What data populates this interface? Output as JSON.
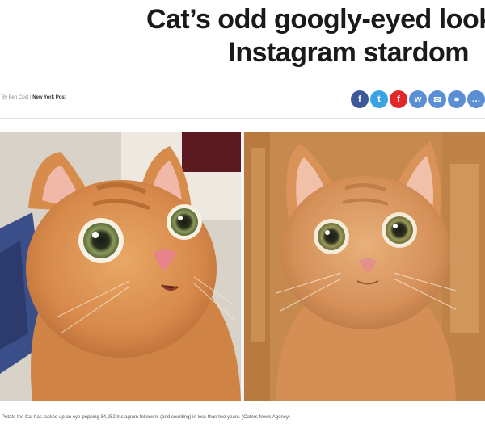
{
  "article": {
    "headline_line1": "Cat’s odd googly-eyed look e",
    "headline_line2": "Instagram stardom",
    "byline_prefix": "By Ben Cost",
    "byline_sep": " | ",
    "publication": "New York Post",
    "caption": "Potato the Cat has racked up an eye-popping 34,252 Instagram followers (and counting) in less than two years. (Caters News Agency)"
  },
  "share_buttons": [
    {
      "icon": "facebook-icon",
      "glyph": "f",
      "color": "#3b5998"
    },
    {
      "icon": "twitter-icon",
      "glyph": "t",
      "color": "#3aa3e3"
    },
    {
      "icon": "flipboard-icon",
      "glyph": "f",
      "color": "#e12828"
    },
    {
      "icon": "whatsapp-icon",
      "glyph": "w",
      "color": "#5a8fd6"
    },
    {
      "icon": "email-icon",
      "glyph": "✉",
      "color": "#5a8fd6"
    },
    {
      "icon": "copy-link-icon",
      "glyph": "⚭",
      "color": "#5a8fd6"
    },
    {
      "icon": "more-icon",
      "glyph": "…",
      "color": "#5a8fd6"
    }
  ]
}
